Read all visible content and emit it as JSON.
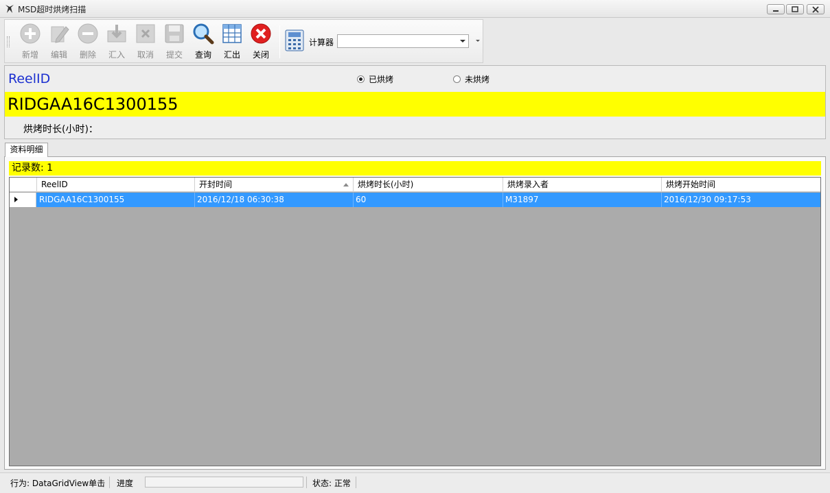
{
  "window": {
    "title": "MSD超时烘烤扫描"
  },
  "toolbar": {
    "buttons": [
      {
        "label": "新增",
        "icon": "plus-circle-icon",
        "enabled": false
      },
      {
        "label": "编辑",
        "icon": "pencil-icon",
        "enabled": false
      },
      {
        "label": "删除",
        "icon": "minus-circle-icon",
        "enabled": false
      },
      {
        "label": "汇入",
        "icon": "import-box-icon",
        "enabled": false
      },
      {
        "label": "取消",
        "icon": "cancel-x-icon",
        "enabled": false
      },
      {
        "label": "提交",
        "icon": "save-disk-icon",
        "enabled": false
      },
      {
        "label": "查询",
        "icon": "magnifier-icon",
        "enabled": true
      },
      {
        "label": "汇出",
        "icon": "grid-table-icon",
        "enabled": true
      },
      {
        "label": "关闭",
        "icon": "close-red-circle-icon",
        "enabled": true
      }
    ],
    "calculator_label": "计算器",
    "calculator_value": ""
  },
  "reel": {
    "label": "ReelID",
    "value": "RIDGAA16C1300155",
    "bake_duration_label": "烘烤时长(小时)：",
    "radio_baked": "已烘烤",
    "radio_not_baked": "未烘烤",
    "selected": "已烘烤"
  },
  "tab": {
    "label": "资料明细",
    "record_count_text": "记录数: 1"
  },
  "grid": {
    "columns": [
      "ReelID",
      "开封时间",
      "烘烤时长(小时)",
      "烘烤录入者",
      "烘烤开始时间"
    ],
    "sorted_column": "开封时间",
    "sort_direction": "ascending",
    "rows": [
      {
        "reel_id": "RIDGAA16C1300155",
        "open_time": "2016/12/18 06:30:38",
        "bake_hours": "60",
        "operator": "M31897",
        "bake_start": "2016/12/30 09:17:53"
      }
    ],
    "selection_color": "#3399ff"
  },
  "statusbar": {
    "action": "行为: DataGridView单击",
    "progress_label": "进度",
    "progress_value": 0,
    "status": "状态: 正常"
  },
  "colors": {
    "highlight_yellow": "#ffff00",
    "reel_label_blue": "#1b2fd0",
    "close_red": "#e02020"
  }
}
